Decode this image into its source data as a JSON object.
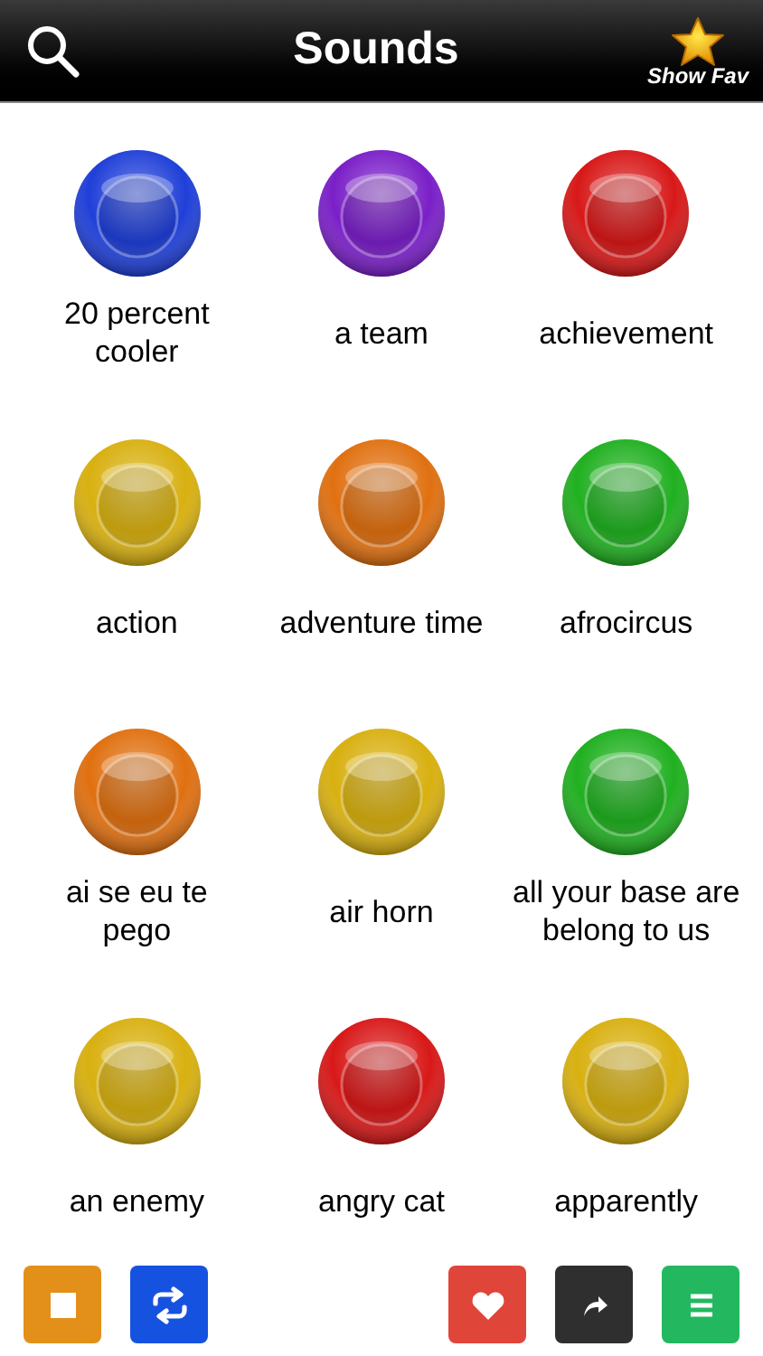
{
  "header": {
    "title": "Sounds",
    "fav_label": "Show Fav"
  },
  "sounds": [
    {
      "label": "20 percent\ncooler",
      "color": "#1f3fd8"
    },
    {
      "label": "a team",
      "color": "#7a1fc8"
    },
    {
      "label": "achievement",
      "color": "#d81818"
    },
    {
      "label": "action",
      "color": "#d8b010"
    },
    {
      "label": "adventure time",
      "color": "#e07010"
    },
    {
      "label": "afrocircus",
      "color": "#20b020"
    },
    {
      "label": "ai se eu te\npego",
      "color": "#e07010"
    },
    {
      "label": "air horn",
      "color": "#d8b010"
    },
    {
      "label": "all your base are\nbelong to us",
      "color": "#20b020"
    },
    {
      "label": "an enemy",
      "color": "#d8b010"
    },
    {
      "label": "angry cat",
      "color": "#d81818"
    },
    {
      "label": "apparently",
      "color": "#d8b010"
    }
  ],
  "toolbar": [
    {
      "kind": "stop",
      "color": "#e3901a"
    },
    {
      "kind": "repeat",
      "color": "#1652e0"
    },
    {
      "kind": "spacer"
    },
    {
      "kind": "heart",
      "color": "#e0453a"
    },
    {
      "kind": "share",
      "color": "#2f2f2f"
    },
    {
      "kind": "menu",
      "color": "#23b85f"
    }
  ]
}
